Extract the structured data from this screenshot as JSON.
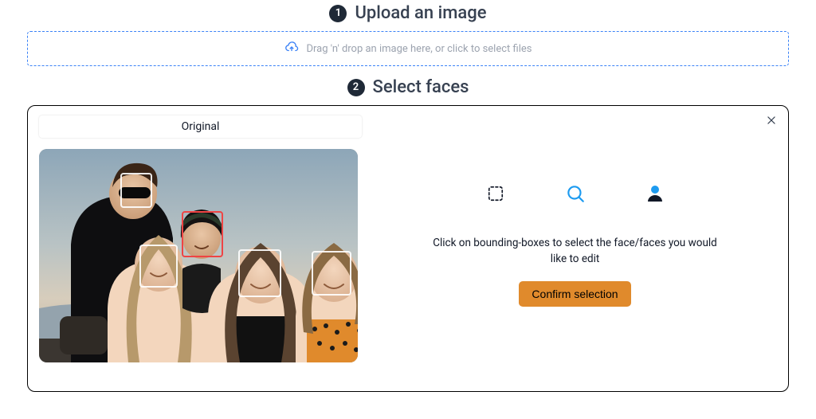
{
  "steps": {
    "one": {
      "num": "1",
      "title": "Upload an image"
    },
    "two": {
      "num": "2",
      "title": "Select faces"
    }
  },
  "dropzone": {
    "text": "Drag 'n' drop an image here, or click to select files"
  },
  "tabs": {
    "original": "Original"
  },
  "faces": {
    "count": 5,
    "selected_index": 2
  },
  "right": {
    "instruction": "Click on bounding-boxes to select the face/faces you would like to edit",
    "confirm_label": "Confirm selection"
  },
  "icons": {
    "upload": "cloud-upload-icon",
    "close": "close-icon",
    "dashed_box": "dashed-selection-icon",
    "magnifier": "magnifier-icon",
    "person": "person-icon"
  }
}
